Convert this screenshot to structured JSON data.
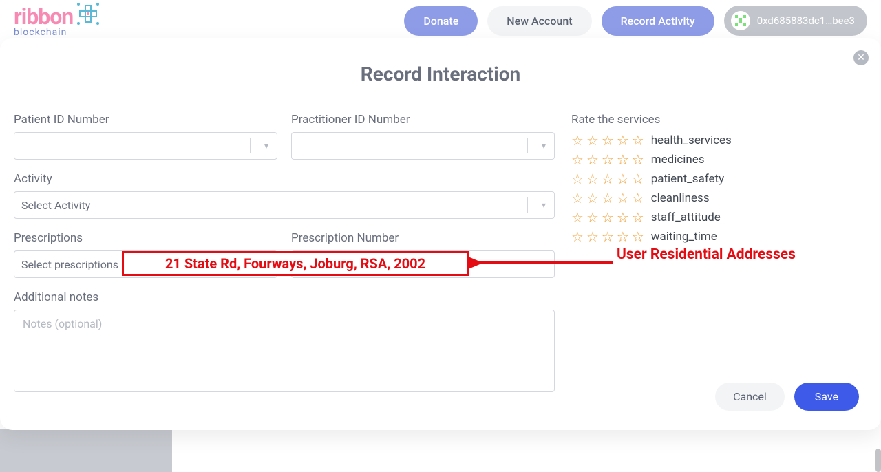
{
  "brand": {
    "name": "ribbon",
    "sub": "blockchain"
  },
  "nav": {
    "donate": "Donate",
    "new_account": "New Account",
    "record_activity": "Record Activity",
    "wallet": "0xd685883dc1…bee3"
  },
  "modal": {
    "title": "Record Interaction",
    "patient_id_label": "Patient ID Number",
    "practitioner_id_label": "Practitioner ID Number",
    "activity_label": "Activity",
    "activity_placeholder": "Select Activity",
    "prescriptions_label": "Prescriptions",
    "prescriptions_placeholder": "Select prescriptions",
    "prescription_number_label": "Prescription Number",
    "prescription_number_placeholder": "Prescription Number",
    "notes_label": "Additional notes",
    "notes_placeholder": "Notes (optional)",
    "rate_label": "Rate the services",
    "ratings": [
      "health_services",
      "medicines",
      "patient_safety",
      "cleanliness",
      "staff_attitude",
      "waiting_time"
    ],
    "cancel": "Cancel",
    "save": "Save"
  },
  "annotation": {
    "address": "21 State Rd, Fourways, Joburg, RSA, 2002",
    "label": "User Residential Addresses"
  }
}
